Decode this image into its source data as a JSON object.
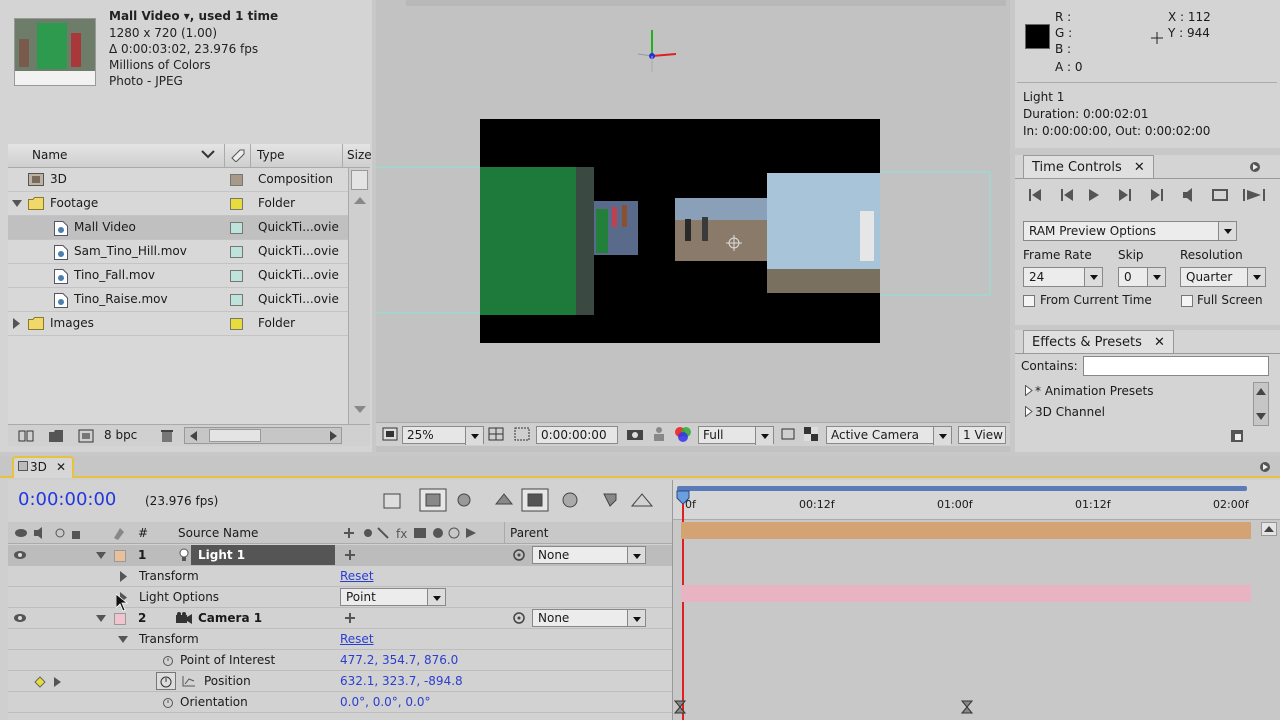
{
  "project": {
    "footage_title": "Mall Video ▾, used 1 time",
    "footage_dims": "1280 x 720 (1.00)",
    "footage_duration": "Δ 0:00:03:02, 23.976 fps",
    "footage_colors": "Millions of Colors",
    "footage_type": "Photo - JPEG",
    "columns": {
      "name": "Name",
      "type": "Type",
      "size": "Size"
    },
    "items": [
      {
        "name": "3D",
        "type": "Composition",
        "swatch": "#a89a88"
      },
      {
        "name": "Footage",
        "type": "Folder",
        "swatch": "#e6dd3c"
      },
      {
        "name": "Mall Video",
        "type": "QuickTi...ovie",
        "swatch": "#bfe3da"
      },
      {
        "name": "Sam_Tino_Hill.mov",
        "type": "QuickTi...ovie",
        "swatch": "#bfe3da"
      },
      {
        "name": "Tino_Fall.mov",
        "type": "QuickTi...ovie",
        "swatch": "#bfe3da"
      },
      {
        "name": "Tino_Raise.mov",
        "type": "QuickTi...ovie",
        "swatch": "#bfe3da"
      },
      {
        "name": "Images",
        "type": "Folder",
        "swatch": "#e6dd3c"
      }
    ],
    "bpc": "8 bpc"
  },
  "viewer": {
    "zoom": "25%",
    "timecode": "0:00:00:00",
    "resolution": "Full",
    "view": "Active Camera",
    "layout": "1 View"
  },
  "info": {
    "r": "R :",
    "g": "G :",
    "b": "B :",
    "a": "A : 0",
    "x": "X : 112",
    "y": "Y : 944",
    "layer_name": "Light 1",
    "duration": "Duration: 0:00:02:01",
    "inout": "In: 0:00:00:00, Out: 0:00:02:00"
  },
  "time_controls": {
    "tab": "Time Controls",
    "ram_preview": "RAM Preview Options",
    "frame_rate_label": "Frame Rate",
    "skip_label": "Skip",
    "resolution_label": "Resolution",
    "frame_rate": "24",
    "skip": "0",
    "resolution": "Quarter",
    "from_current": "From Current Time",
    "full_screen": "Full Screen"
  },
  "effects": {
    "tab": "Effects & Presets",
    "contains_label": "Contains:",
    "items": [
      "* Animation Presets",
      "3D Channel"
    ]
  },
  "timeline": {
    "tab": "3D",
    "timecode": "0:00:00:00",
    "fps": "(23.976 fps)",
    "col_hash": "#",
    "col_source": "Source Name",
    "col_parent": "Parent",
    "ruler": [
      "0f",
      "00:12f",
      "01:00f",
      "01:12f",
      "02:00f"
    ],
    "layers": [
      {
        "num": "1",
        "name": "Light 1",
        "parent": "None",
        "bar_color": "#d4a373"
      },
      {
        "num": "2",
        "name": "Camera 1",
        "parent": "None",
        "bar_color": "#e8b4c4"
      }
    ],
    "light_props": {
      "transform": "Transform",
      "transform_val": "Reset",
      "light_options": "Light Options",
      "light_type": "Point"
    },
    "camera_props": {
      "transform": "Transform",
      "transform_val": "Reset",
      "poi": "Point of Interest",
      "poi_val": "477.2, 354.7, 876.0",
      "position": "Position",
      "position_val": "632.1, 323.7, -894.8",
      "orientation": "Orientation",
      "orientation_val": "0.0°, 0.0°, 0.0°"
    }
  }
}
